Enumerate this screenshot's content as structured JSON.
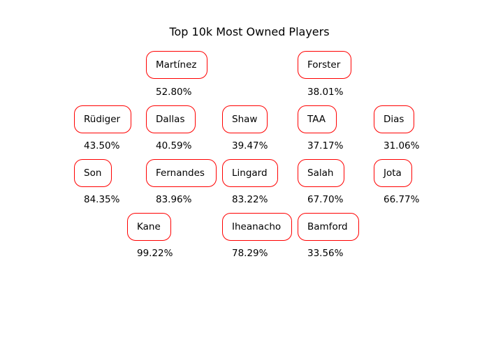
{
  "title": "Top 10k Most Owned Players",
  "accent_color": "#ff0000",
  "rows": [
    [
      {
        "name": "Martínez",
        "ownership": "52.80%"
      },
      {
        "name": "Forster",
        "ownership": "38.01%"
      }
    ],
    [
      {
        "name": "Rüdiger",
        "ownership": "43.50%"
      },
      {
        "name": "Dallas",
        "ownership": "40.59%"
      },
      {
        "name": "Shaw",
        "ownership": "39.47%"
      },
      {
        "name": "TAA",
        "ownership": "37.17%"
      },
      {
        "name": "Dias",
        "ownership": "31.06%"
      }
    ],
    [
      {
        "name": "Son",
        "ownership": "84.35%"
      },
      {
        "name": "Fernandes",
        "ownership": "83.96%"
      },
      {
        "name": "Lingard",
        "ownership": "83.22%"
      },
      {
        "name": "Salah",
        "ownership": "67.70%"
      },
      {
        "name": "Jota",
        "ownership": "66.77%"
      }
    ],
    [
      {
        "name": "Kane",
        "ownership": "99.22%"
      },
      {
        "name": "Iheanacho",
        "ownership": "78.29%"
      },
      {
        "name": "Bamford",
        "ownership": "33.56%"
      }
    ]
  ]
}
